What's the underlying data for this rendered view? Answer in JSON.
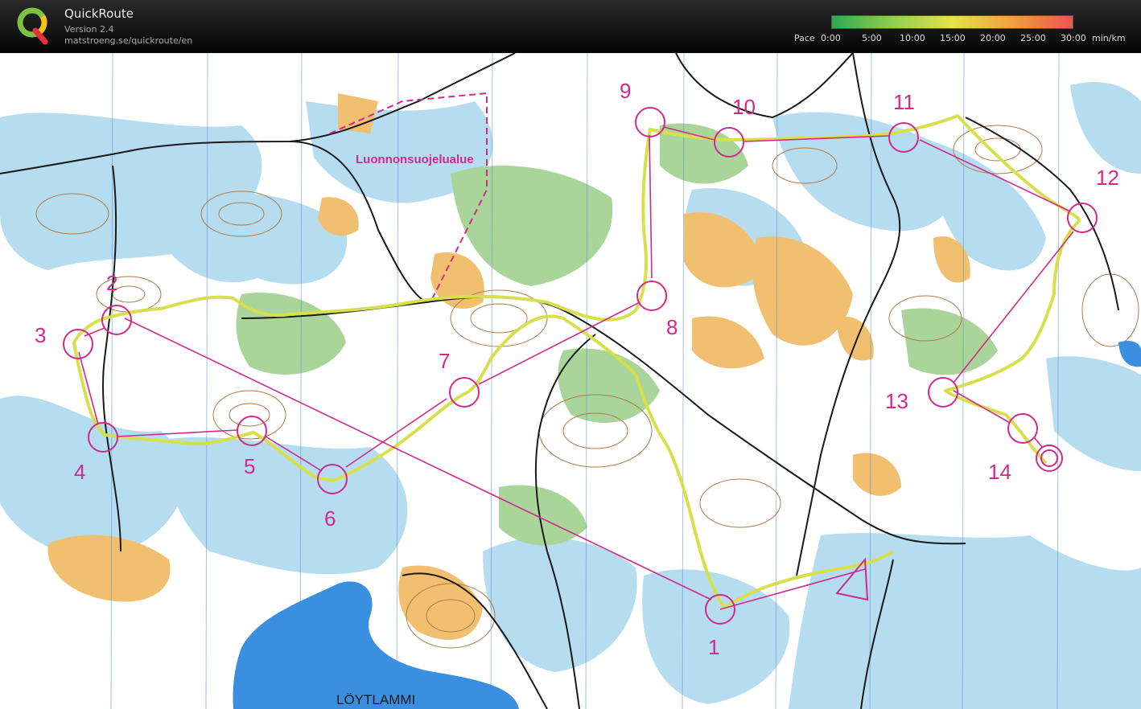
{
  "header": {
    "app_name": "QuickRoute",
    "version": "Version 2.4",
    "url": "matstroeng.se/quickroute/en",
    "pace_label": "Pace",
    "pace_ticks": [
      "0:00",
      "5:00",
      "10:00",
      "15:00",
      "20:00",
      "25:00",
      "30:00"
    ],
    "pace_unit": "min/km",
    "pace_colors": [
      "#2fa84f",
      "#8fcf50",
      "#e6e14c",
      "#f0a040",
      "#e8554f"
    ]
  },
  "map": {
    "colors": {
      "open_land": "#ffffff",
      "forest": "#b6dcef",
      "green_vegetation": "#a9d59a",
      "rough_open": "#f0c070",
      "contour": "#b07a45",
      "track": "#1a1a1a",
      "water": "#3b8fe0",
      "course": "#d02a8c",
      "route": "#d7e04a"
    },
    "protected_area_label": "Luonnonsuojelualue",
    "lake_label": "LÖYTLAMMI",
    "controls": [
      {
        "number": "1"
      },
      {
        "number": "2"
      },
      {
        "number": "3"
      },
      {
        "number": "4"
      },
      {
        "number": "5"
      },
      {
        "number": "6"
      },
      {
        "number": "7"
      },
      {
        "number": "8"
      },
      {
        "number": "9"
      },
      {
        "number": "10"
      },
      {
        "number": "11"
      },
      {
        "number": "12"
      },
      {
        "number": "13"
      },
      {
        "number": "14"
      }
    ],
    "start_symbol": "start-triangle-icon",
    "finish_symbol": "finish-double-circle-icon"
  }
}
